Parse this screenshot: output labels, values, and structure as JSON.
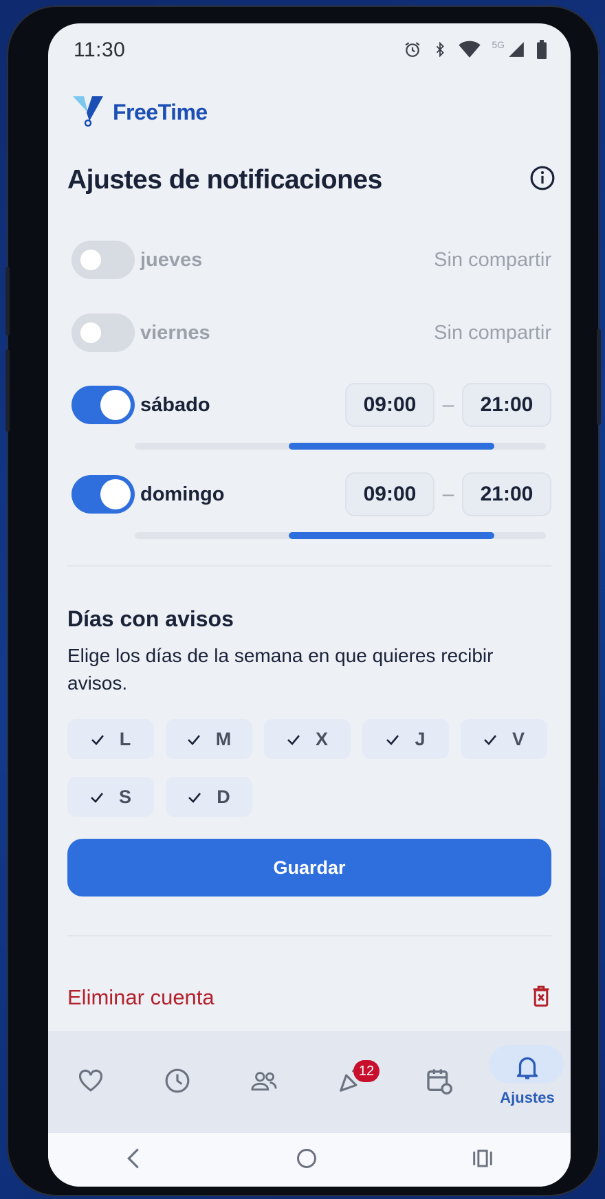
{
  "status_bar": {
    "time": "11:30",
    "network": "5G"
  },
  "app": {
    "name": "FreeTime"
  },
  "page": {
    "title": "Ajustes de notificaciones"
  },
  "days": [
    {
      "label": "jueves",
      "enabled": false,
      "status": "Sin compartir"
    },
    {
      "label": "viernes",
      "enabled": false,
      "status": "Sin compartir"
    },
    {
      "label": "sábado",
      "enabled": true,
      "start": "09:00",
      "separator": "–",
      "end": "21:00",
      "range_fraction": [
        0.375,
        0.875
      ]
    },
    {
      "label": "domingo",
      "enabled": true,
      "start": "09:00",
      "separator": "–",
      "end": "21:00",
      "range_fraction": [
        0.375,
        0.875
      ]
    }
  ],
  "reminders": {
    "title": "Días con avisos",
    "description": "Elige los días de la semana en que quieres recibir avisos.",
    "chips": [
      {
        "label": "L",
        "checked": true
      },
      {
        "label": "M",
        "checked": true
      },
      {
        "label": "X",
        "checked": true
      },
      {
        "label": "J",
        "checked": true
      },
      {
        "label": "V",
        "checked": true
      },
      {
        "label": "S",
        "checked": true
      },
      {
        "label": "D",
        "checked": true
      }
    ]
  },
  "actions": {
    "save_label": "Guardar",
    "delete_label": "Eliminar cuenta"
  },
  "bottom_nav": {
    "items": [
      {
        "icon": "heart-icon"
      },
      {
        "icon": "clock-icon"
      },
      {
        "icon": "people-icon"
      },
      {
        "icon": "party-icon",
        "badge": "12"
      },
      {
        "icon": "calendar-icon"
      },
      {
        "icon": "bell-icon",
        "label": "Ajustes",
        "active": true
      }
    ]
  },
  "colors": {
    "accent": "#2f6fdd",
    "danger": "#b3212b",
    "brand": "#1b4fb3",
    "badge": "#c8102e"
  }
}
